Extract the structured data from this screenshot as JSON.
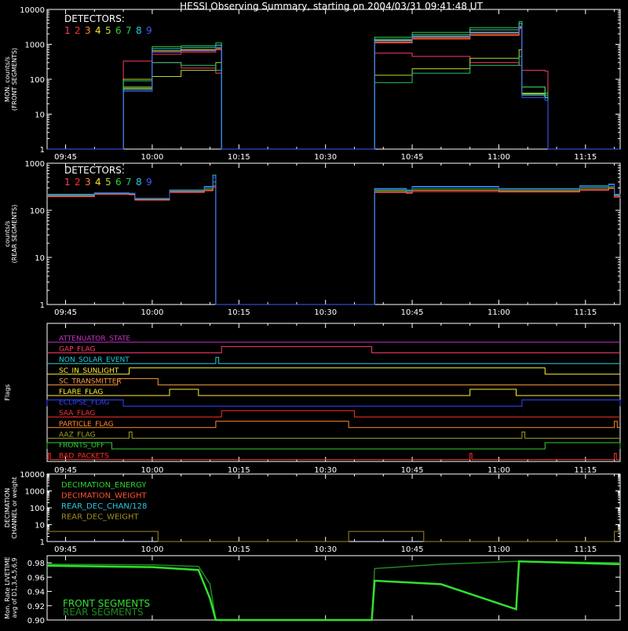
{
  "title": "HESSI Observing Summary, starting on 2004/03/31 09:41:48 UT",
  "time_ticks": [
    "09:45",
    "10:00",
    "10:15",
    "10:30",
    "10:45",
    "11:00",
    "11:15"
  ],
  "detectors": {
    "label": "DETECTORS:",
    "items": [
      {
        "num": "1",
        "color": "#ff3b6b"
      },
      {
        "num": "2",
        "color": "#ff3030"
      },
      {
        "num": "3",
        "color": "#ff8a2a"
      },
      {
        "num": "4",
        "color": "#ffe02a"
      },
      {
        "num": "5",
        "color": "#b7d826"
      },
      {
        "num": "6",
        "color": "#30d030"
      },
      {
        "num": "7",
        "color": "#1fc86e"
      },
      {
        "num": "8",
        "color": "#2ac8e0"
      },
      {
        "num": "9",
        "color": "#3b5bff"
      }
    ]
  },
  "flag_names": [
    {
      "text": "ATTENUATOR_STATE",
      "color": "#cc33cc"
    },
    {
      "text": "GAP_FLAG",
      "color": "#ff3b6b"
    },
    {
      "text": "NON_SOLAR_EVENT",
      "color": "#20d0e0"
    },
    {
      "text": "SC_IN_SUNLIGHT",
      "color": "#ffee33"
    },
    {
      "text": "SC_TRANSMITTER",
      "color": "#ff9944"
    },
    {
      "text": "FLARE_FLAG",
      "color": "#ffee33"
    },
    {
      "text": "ECLIPSE_FLAG",
      "color": "#3344ff"
    },
    {
      "text": "SAA_FLAG",
      "color": "#ff3030"
    },
    {
      "text": "PARTICLE_FLAG",
      "color": "#ff8a2a"
    },
    {
      "text": "AAZ_FLAG",
      "color": "#a0a020"
    },
    {
      "text": "FRONTS_OFF",
      "color": "#30d030"
    },
    {
      "text": "BAD_PACKETS",
      "color": "#ff3030"
    }
  ],
  "decimation_legend": [
    {
      "text": "DECIMATION_ENERGY",
      "color": "#30d030"
    },
    {
      "text": "DECIMATION_WEIGHT",
      "color": "#ff5030"
    },
    {
      "text": "REAR_DEC_CHAN/128",
      "color": "#2ac8e0"
    },
    {
      "text": "REAR_DEC_WEIGHT",
      "color": "#a08a20"
    }
  ],
  "livetime_legend": [
    {
      "text": "FRONT SEGMENTS",
      "color": "#30e030"
    },
    {
      "text": "REAR SEGMENTS",
      "color": "#1f8a1f"
    }
  ],
  "chart_data": {
    "type": "line",
    "x_unit": "UT time",
    "xlim": [
      "09:41:48",
      "11:21:00"
    ],
    "panels": [
      {
        "id": "front",
        "ylabel": "MON. counts/s (FRONT SEGMENTS)",
        "yscale": "log",
        "ylim": [
          1,
          10000
        ],
        "ytick_labels": [
          "1",
          "10",
          "100",
          "1000",
          "10000"
        ],
        "x_times": [
          "09:41:48",
          "09:54",
          "09:55",
          "10:00",
          "10:05",
          "10:11",
          "10:12",
          "10:38",
          "10:38:30",
          "10:45",
          "10:55",
          "11:03:30",
          "11:04",
          "11:08",
          "11:08:30",
          "11:21"
        ],
        "series": [
          {
            "color": "#ff3b6b",
            "values": [
              1,
              1,
              330,
              300,
              210,
              150,
              1,
              1,
              560,
              450,
              300,
              250,
              180,
              170,
              1,
              1
            ]
          },
          {
            "color": "#ff3030",
            "values": [
              1,
              1,
              60,
              520,
              600,
              700,
              1,
              1,
              1100,
              1400,
              1800,
              2800,
              40,
              30,
              1,
              1
            ]
          },
          {
            "color": "#ff8a2a",
            "values": [
              1,
              1,
              60,
              600,
              650,
              750,
              1,
              1,
              1150,
              1500,
              1900,
              3000,
              40,
              30,
              1,
              1
            ]
          },
          {
            "color": "#ffe02a",
            "values": [
              1,
              1,
              55,
              650,
              700,
              800,
              1,
              1,
              1300,
              1700,
              2200,
              3200,
              38,
              30,
              1,
              1
            ]
          },
          {
            "color": "#b7d826",
            "values": [
              1,
              1,
              100,
              120,
              180,
              300,
              1,
              1,
              130,
              200,
              400,
              700,
              60,
              40,
              1,
              1
            ]
          },
          {
            "color": "#30d030",
            "values": [
              1,
              1,
              60,
              850,
              900,
              1100,
              1,
              1,
              1600,
              2200,
              3000,
              4500,
              40,
              35,
              1,
              1
            ]
          },
          {
            "color": "#1fc86e",
            "values": [
              1,
              1,
              90,
              300,
              250,
              180,
              1,
              1,
              80,
              150,
              250,
              450,
              60,
              40,
              1,
              1
            ]
          },
          {
            "color": "#2ac8e0",
            "values": [
              1,
              1,
              50,
              750,
              800,
              950,
              1,
              1,
              1400,
              1900,
              2600,
              4000,
              35,
              30,
              1,
              1
            ]
          },
          {
            "color": "#3b5bff",
            "values": [
              1,
              1,
              45,
              600,
              650,
              800,
              1,
              1,
              1200,
              1600,
              2100,
              3300,
              30,
              25,
              1,
              1
            ]
          }
        ]
      },
      {
        "id": "rear",
        "ylabel": "counts/s (REAR SEGMENTS)",
        "yscale": "log",
        "ylim": [
          1,
          1000
        ],
        "ytick_labels": [
          "1",
          "10",
          "100",
          "1000"
        ],
        "x_times": [
          "09:41:48",
          "09:50",
          "09:56",
          "09:57",
          "10:03",
          "10:09",
          "10:10:30",
          "10:11",
          "10:38",
          "10:38:30",
          "10:44",
          "10:45",
          "11:00",
          "11:14",
          "11:19",
          "11:20",
          "11:21"
        ],
        "series": [
          {
            "color": "#ff3b6b",
            "values": [
              195,
              220,
              215,
              165,
              240,
              260,
              310,
              1,
              1,
              240,
              230,
              250,
              245,
              265,
              290,
              190,
              180
            ]
          },
          {
            "color": "#ff8a2a",
            "values": [
              200,
              225,
              220,
              170,
              250,
              270,
              330,
              1,
              1,
              250,
              240,
              265,
              255,
              280,
              300,
              200,
              190
            ]
          },
          {
            "color": "#30d030",
            "values": [
              210,
              230,
              225,
              175,
              260,
              290,
              400,
              1,
              1,
              265,
              255,
              285,
              270,
              300,
              320,
              210,
              200
            ]
          },
          {
            "color": "#2ac8e0",
            "values": [
              220,
              235,
              230,
              180,
              270,
              320,
              560,
              1,
              1,
              290,
              270,
              320,
              290,
              330,
              360,
              220,
              210
            ]
          },
          {
            "color": "#3b5bff",
            "values": [
              215,
              232,
              228,
              178,
              265,
              310,
              500,
              1,
              1,
              280,
              265,
              310,
              285,
              320,
              350,
              215,
              205
            ]
          }
        ]
      },
      {
        "id": "flags",
        "ylabel": "Flags",
        "flags": [
          {
            "name": "ATTENUATOR_STATE",
            "intervals": []
          },
          {
            "name": "GAP_FLAG",
            "intervals": [
              [
                "10:12",
                "10:38"
              ]
            ]
          },
          {
            "name": "NON_SOLAR_EVENT",
            "intervals": [
              [
                "10:11",
                "10:11:30"
              ]
            ]
          },
          {
            "name": "SC_IN_SUNLIGHT",
            "intervals": [
              [
                "09:56",
                "11:08"
              ]
            ]
          },
          {
            "name": "SC_TRANSMITTER",
            "intervals": [
              [
                "09:54",
                "10:01"
              ]
            ]
          },
          {
            "name": "FLARE_FLAG",
            "intervals": [
              [
                "10:03",
                "10:08"
              ],
              [
                "10:55",
                "11:03"
              ]
            ]
          },
          {
            "name": "ECLIPSE_FLAG",
            "intervals": [
              [
                "09:41:48",
                "09:55"
              ],
              [
                "11:04",
                "11:21"
              ]
            ]
          },
          {
            "name": "SAA_FLAG",
            "intervals": [
              [
                "10:12",
                "10:35"
              ]
            ]
          },
          {
            "name": "PARTICLE_FLAG",
            "intervals": [
              [
                "10:11",
                "10:34"
              ],
              [
                "11:20",
                "11:20:30"
              ]
            ]
          },
          {
            "name": "AAZ_FLAG",
            "intervals": [
              [
                "09:56",
                "09:56:30"
              ],
              [
                "11:04",
                "11:04:30"
              ]
            ]
          },
          {
            "name": "FRONTS_OFF",
            "intervals": [
              [
                "09:41:48",
                "09:53"
              ],
              [
                "11:08",
                "11:21"
              ]
            ]
          },
          {
            "name": "BAD_PACKETS",
            "intervals": [
              [
                "09:42",
                "09:42:20"
              ],
              [
                "10:55",
                "10:55:20"
              ],
              [
                "11:20",
                "11:20:20"
              ]
            ]
          }
        ]
      },
      {
        "id": "decimation",
        "ylabel": "DECIMATION CHANNEL or weight",
        "yscale": "log",
        "ylim": [
          1,
          10000
        ],
        "ytick_labels": [
          "1",
          "10",
          "100",
          "1000",
          "10000"
        ],
        "series": [
          {
            "name": "DECIMATION_WEIGHT",
            "color": "#ff5030",
            "x_times": [],
            "values": []
          },
          {
            "name": "REAR_DEC_WEIGHT",
            "color": "#a08a20",
            "x_times": [
              "09:41:48",
              "10:01",
              "10:01",
              "10:34",
              "10:34",
              "10:47",
              "10:47",
              "11:20",
              "11:20",
              "11:21"
            ],
            "values": [
              4,
              4,
              1,
              1,
              4,
              4,
              1,
              1,
              4,
              4
            ]
          }
        ]
      },
      {
        "id": "livetime",
        "ylabel": "Mon. Rate LIVETIME avg of D1,3,4,5,6,9",
        "ylim": [
          0.9,
          0.99
        ],
        "ytick_labels": [
          "0.90",
          "0.92",
          "0.94",
          "0.96",
          "0.98"
        ],
        "series": [
          {
            "name": "FRONT SEGMENTS",
            "color": "#30e030",
            "x_times": [
              "09:41:48",
              "10:00",
              "10:08",
              "10:10",
              "10:11",
              "10:38",
              "10:38:30",
              "10:50",
              "11:03",
              "11:03:30",
              "11:21"
            ],
            "values": [
              0.976,
              0.974,
              0.97,
              0.93,
              0.9,
              0.9,
              0.955,
              0.95,
              0.915,
              0.982,
              0.978
            ]
          },
          {
            "name": "REAR SEGMENTS",
            "color": "#1f8a1f",
            "x_times": [
              "09:41:48",
              "10:00",
              "10:08",
              "10:10",
              "10:11",
              "10:38",
              "10:38:30",
              "10:50",
              "11:03",
              "11:03:30",
              "11:21"
            ],
            "values": [
              0.978,
              0.977,
              0.975,
              0.95,
              0.9,
              0.9,
              0.972,
              0.978,
              0.982,
              0.982,
              0.98
            ]
          }
        ]
      }
    ]
  }
}
